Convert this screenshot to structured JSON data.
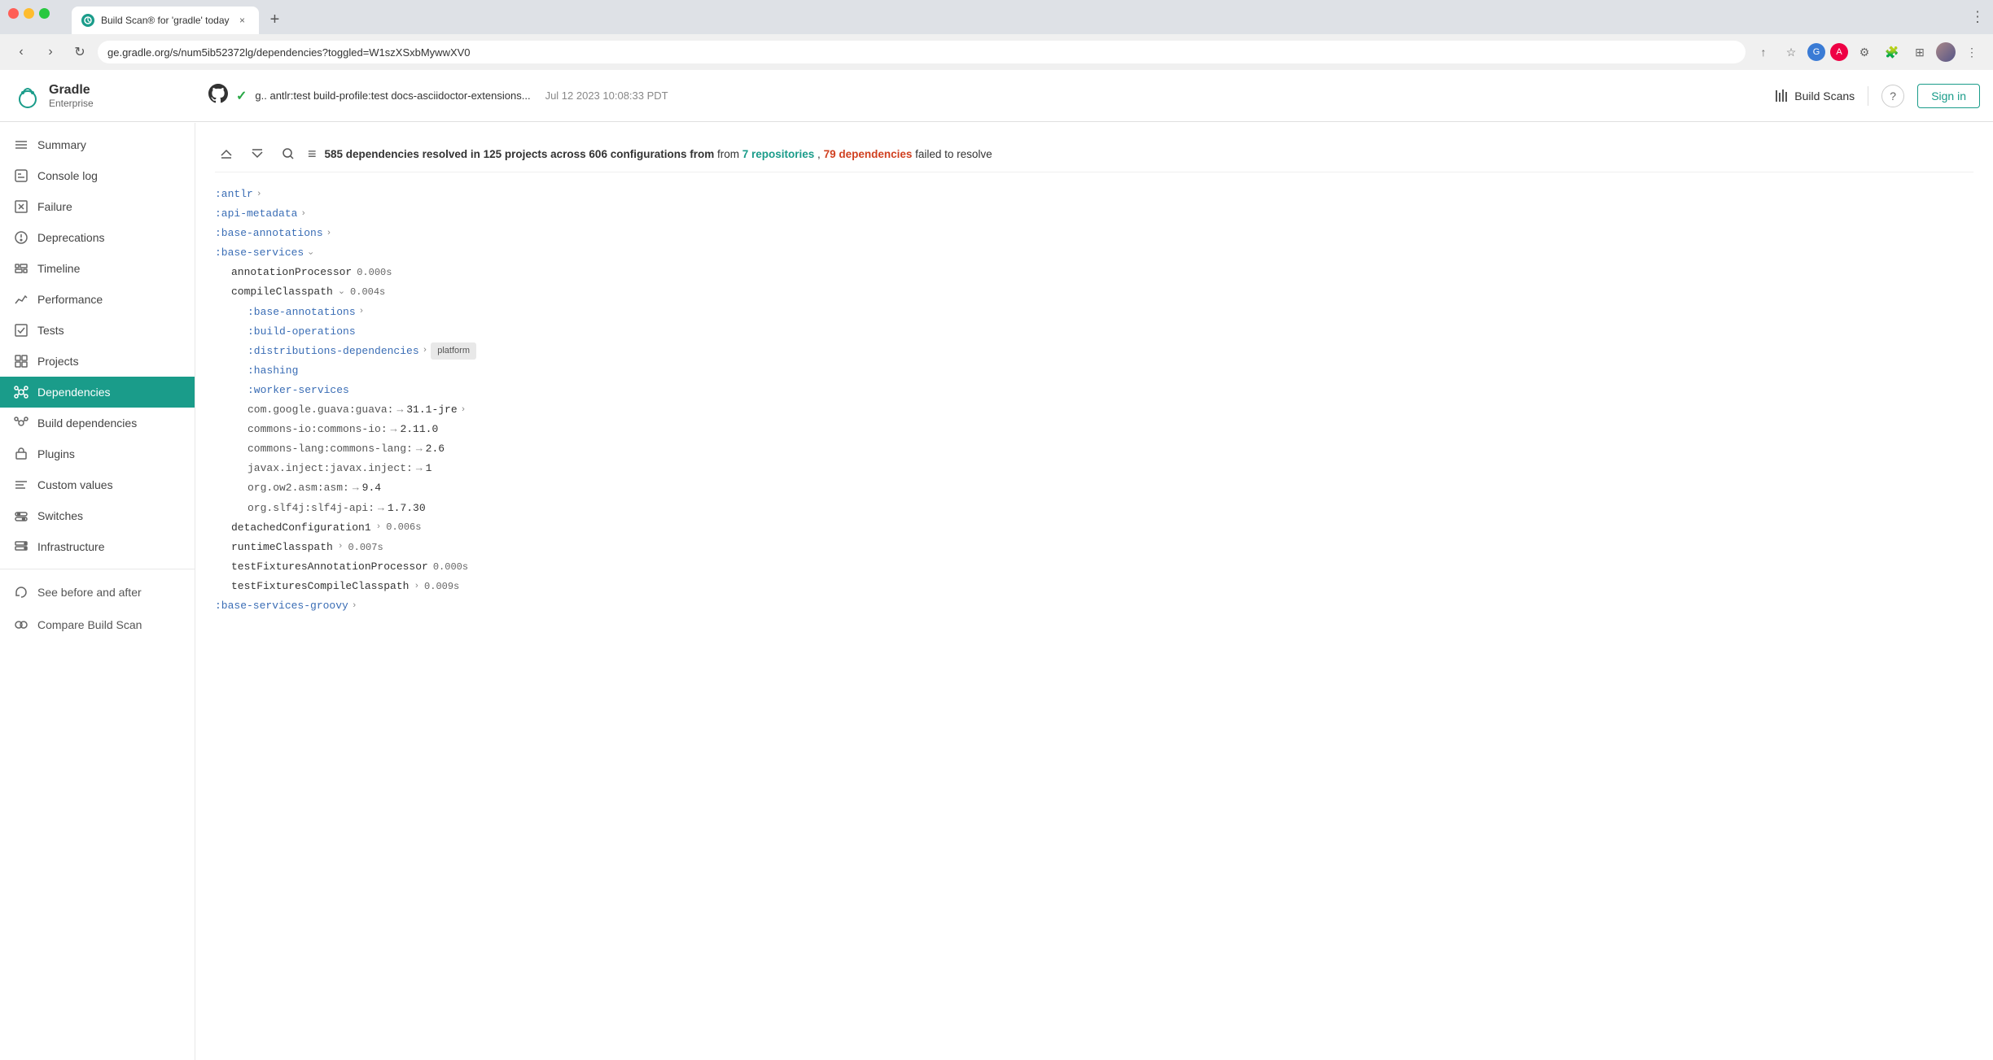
{
  "browser": {
    "window_controls": [
      "close",
      "minimize",
      "maximize"
    ],
    "tab": {
      "favicon_color": "#1a9c8a",
      "title": "Build Scan® for 'gradle' today",
      "close_label": "×"
    },
    "new_tab_label": "+",
    "address": "ge.gradle.org/s/num5ib52372lg/dependencies?toggled=W1szXSxbMywwXV0",
    "nav_back": "‹",
    "nav_forward": "›",
    "nav_reload": "↻"
  },
  "header": {
    "logo_gradle": "Gradle",
    "logo_enterprise": "Enterprise",
    "build_status": "✓",
    "build_name": "g..  antlr:test build-profile:test docs-asciidoctor-extensions...",
    "build_date": "Jul 12 2023 10:08:33 PDT",
    "build_scans_label": "Build Scans",
    "help_label": "?",
    "sign_in_label": "Sign in"
  },
  "sidebar": {
    "items": [
      {
        "id": "summary",
        "label": "Summary",
        "icon": "≡"
      },
      {
        "id": "console-log",
        "label": "Console log",
        "icon": "□"
      },
      {
        "id": "failure",
        "label": "Failure",
        "icon": "✕"
      },
      {
        "id": "deprecations",
        "label": "Deprecations",
        "icon": "⊙"
      },
      {
        "id": "timeline",
        "label": "Timeline",
        "icon": "⊞"
      },
      {
        "id": "performance",
        "label": "Performance",
        "icon": "∿"
      },
      {
        "id": "tests",
        "label": "Tests",
        "icon": "☑"
      },
      {
        "id": "projects",
        "label": "Projects",
        "icon": "⊡"
      },
      {
        "id": "dependencies",
        "label": "Dependencies",
        "icon": "⊛",
        "active": true
      },
      {
        "id": "build-dependencies",
        "label": "Build dependencies",
        "icon": "⊛"
      },
      {
        "id": "plugins",
        "label": "Plugins",
        "icon": "⊓"
      },
      {
        "id": "custom-values",
        "label": "Custom values",
        "icon": "≡"
      },
      {
        "id": "switches",
        "label": "Switches",
        "icon": "◎"
      },
      {
        "id": "infrastructure",
        "label": "Infrastructure",
        "icon": "⊞"
      }
    ],
    "footer_items": [
      {
        "id": "see-before-after",
        "label": "See before and after",
        "icon": "↺"
      },
      {
        "id": "compare-build-scan",
        "label": "Compare Build Scan",
        "icon": "◎"
      }
    ]
  },
  "dependencies": {
    "summary": "585 dependencies resolved in 125 projects across 606 configurations from",
    "repos_count": "7 repositories",
    "failed_text": "79 dependencies",
    "failed_suffix": "failed to resolve",
    "projects": [
      {
        "name": ":antlr",
        "expanded": false
      },
      {
        "name": ":api-metadata",
        "expanded": false
      },
      {
        "name": ":base-annotations",
        "expanded": false
      },
      {
        "name": ":base-services",
        "expanded": true,
        "configs": [
          {
            "name": "annotationProcessor",
            "time": "0.000s",
            "expanded": false
          },
          {
            "name": "compileClasspath",
            "time": "0.004s",
            "expanded": true,
            "children": [
              {
                "type": "project",
                "name": ":base-annotations",
                "expanded": false
              },
              {
                "type": "project",
                "name": ":build-operations"
              },
              {
                "type": "project",
                "name": ":distributions-dependencies",
                "expanded": false,
                "badge": "platform"
              },
              {
                "type": "project",
                "name": ":hashing"
              },
              {
                "type": "project",
                "name": ":worker-services"
              },
              {
                "type": "artifact",
                "name": "com.google.guava:guava:",
                "arrow": "→",
                "version": "31.1-jre",
                "expanded": false
              },
              {
                "type": "artifact",
                "name": "commons-io:commons-io:",
                "arrow": "→",
                "version": "2.11.0"
              },
              {
                "type": "artifact",
                "name": "commons-lang:commons-lang:",
                "arrow": "→",
                "version": "2.6"
              },
              {
                "type": "artifact",
                "name": "javax.inject:javax.inject:",
                "arrow": "→",
                "version": "1"
              },
              {
                "type": "artifact",
                "name": "org.ow2.asm:asm:",
                "arrow": "→",
                "version": "9.4"
              },
              {
                "type": "artifact",
                "name": "org.slf4j:slf4j-api:",
                "arrow": "→",
                "version": "1.7.30"
              }
            ]
          },
          {
            "name": "detachedConfiguration1",
            "time": "0.006s",
            "expanded": false
          },
          {
            "name": "runtimeClasspath",
            "time": "0.007s",
            "expanded": false
          },
          {
            "name": "testFixturesAnnotationProcessor",
            "time": "0.000s",
            "expanded": false
          },
          {
            "name": "testFixturesCompileClasspath",
            "time": "0.009s",
            "expanded": false
          }
        ]
      },
      {
        "name": ":base-services-groovy",
        "expanded": false
      }
    ]
  }
}
